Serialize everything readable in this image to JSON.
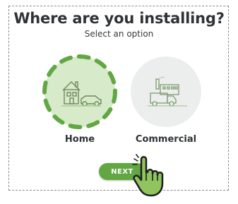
{
  "header": {
    "title": "Where are you installing?",
    "subtitle": "Select an option"
  },
  "options": [
    {
      "label": "Home",
      "selected": true,
      "icon": "house-car-icon"
    },
    {
      "label": "Commercial",
      "selected": false,
      "icon": "factory-truck-icon"
    }
  ],
  "next_button": {
    "label": "NEXT"
  },
  "colors": {
    "accent": "#62a744",
    "selected_bg": "#d7eac9",
    "unselected_bg": "#eceeed",
    "text": "#2f3336"
  }
}
